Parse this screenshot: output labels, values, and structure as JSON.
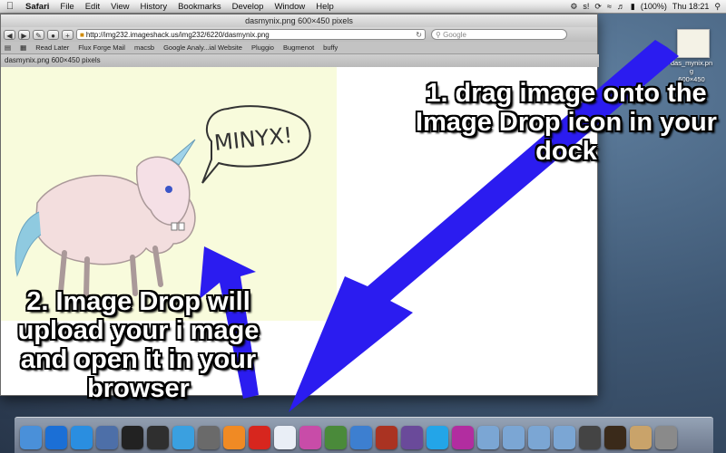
{
  "menubar": {
    "apple": "",
    "items": [
      "Safari",
      "File",
      "Edit",
      "View",
      "History",
      "Bookmarks",
      "Develop",
      "Window",
      "Help"
    ],
    "status": [
      "s!",
      "(100%)",
      "Thu 18:21"
    ]
  },
  "window": {
    "title": "dasmynix.png 600×450 pixels",
    "url": "http://img232.imageshack.us/img232/6220/dasmynix.png",
    "search_placeholder": "Google",
    "bookmarks": [
      "Read Later",
      "Flux Forge Mail",
      "macsb",
      "Google Analy...ial Website",
      "Pluggio",
      "Bugmenot",
      "buffy"
    ],
    "tab": "dasmynix.png 600×450 pixels"
  },
  "image": {
    "speech": "MINYX!"
  },
  "desktop_icon": {
    "label": "das_mynix.pn\ng",
    "dims": "600×450"
  },
  "instructions": {
    "step1": "1. drag image onto the Image Drop icon in your dock",
    "step2": "2. Image Drop will upload your i mage and open it in your browser"
  },
  "dock": {
    "icons": [
      "finder-icon",
      "app-store-icon",
      "safari-icon",
      "preview-icon",
      "terminal-icon",
      "activity-monitor-icon",
      "itunes-icon",
      "alien-icon",
      "vlc-icon",
      "image-drop-icon",
      "textedit-icon",
      "pink-app-icon",
      "checkmark-app-icon",
      "globe-icon",
      "calendar-icon",
      "photo-icon",
      "skype-icon",
      "orb-icon",
      "folder-icon",
      "folder-icon",
      "folder-icon",
      "folder-icon",
      "music-icon",
      "video-icon",
      "coffee-icon",
      "trash-icon"
    ],
    "colors": [
      "#4a90d9",
      "#1b6fd6",
      "#2a8ee0",
      "#4d6fa8",
      "#222222",
      "#2f2f2f",
      "#3aa0e0",
      "#6a6a6a",
      "#f08a24",
      "#d7261e",
      "#e9eef6",
      "#c84ca8",
      "#4a8a3a",
      "#3d7fd0",
      "#aa3322",
      "#6a4a9a",
      "#23a5e8",
      "#b22da0",
      "#7ba6d4",
      "#7ba6d4",
      "#7ba6d4",
      "#7ba6d4",
      "#444444",
      "#3a2a1a",
      "#c9a36a",
      "#8a8a8a"
    ]
  },
  "colors": {
    "arrow": "#2b1cf0"
  }
}
